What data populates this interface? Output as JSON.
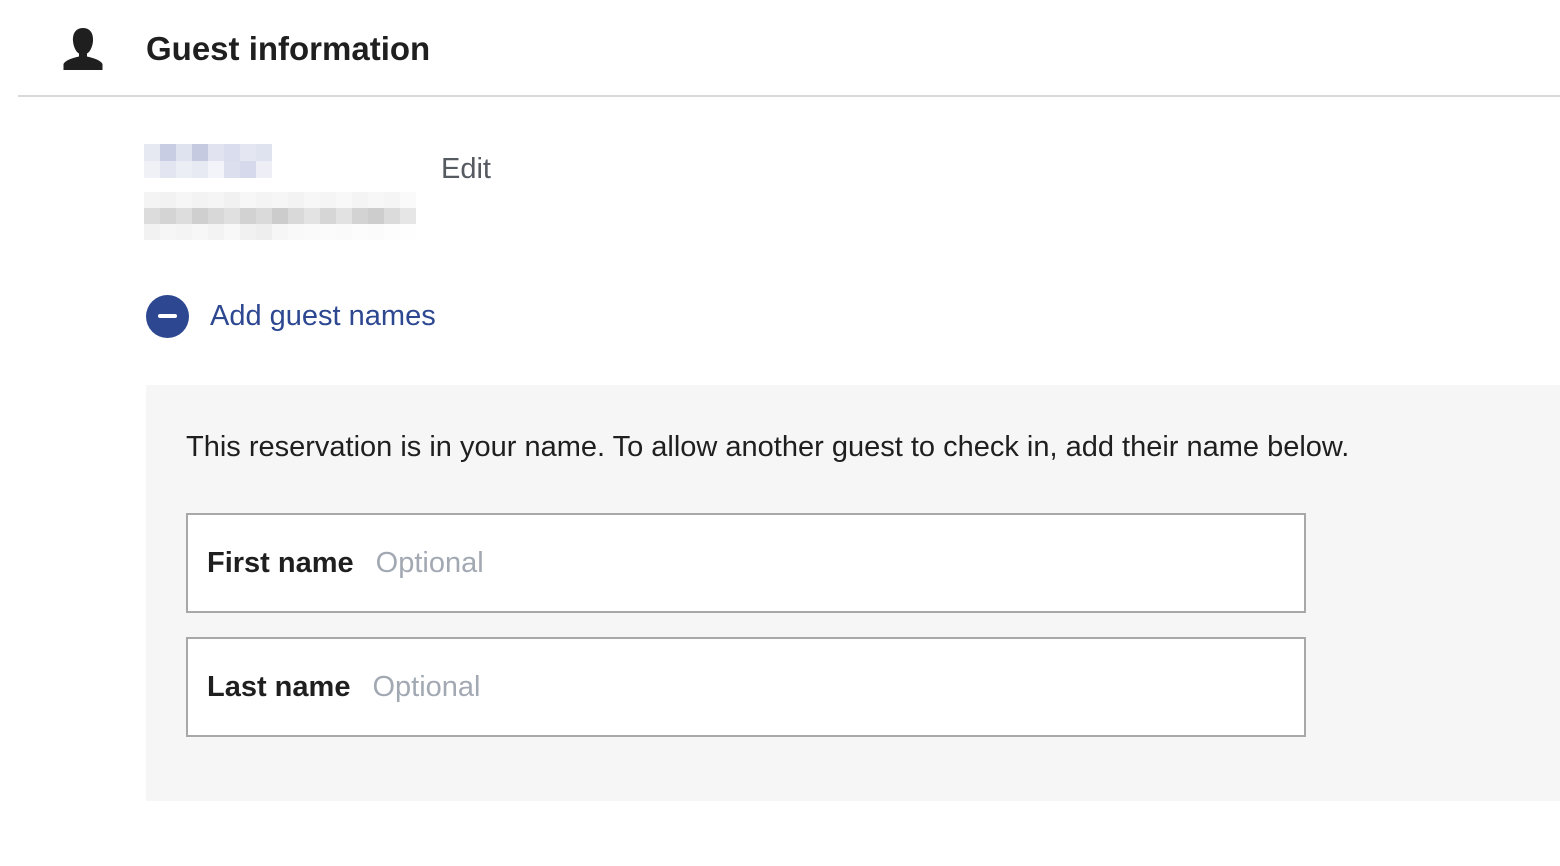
{
  "header": {
    "title": "Guest information",
    "icon": "user-silhouette-icon"
  },
  "guest": {
    "edit_label": "Edit"
  },
  "add_guest": {
    "icon": "minus-circle-icon",
    "label": "Add guest names"
  },
  "panel": {
    "message": "This reservation is in your name. To allow another guest to check in, add their name below.",
    "first_name": {
      "label": "First name",
      "placeholder": "Optional",
      "value": ""
    },
    "last_name": {
      "label": "Last name",
      "placeholder": "Optional",
      "value": ""
    }
  },
  "colors": {
    "accent": "#2d4891",
    "panel_bg": "#f6f6f6",
    "placeholder": "#a3a9b3",
    "field_border": "#a8a8a8",
    "divider": "#d9d9d9"
  }
}
